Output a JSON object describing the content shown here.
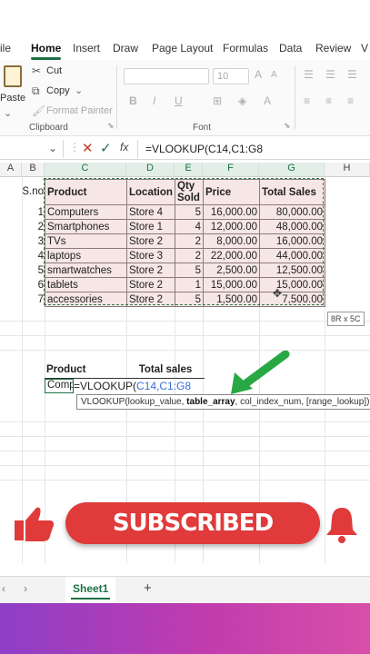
{
  "tabs": [
    "ile",
    "Home",
    "Insert",
    "Draw",
    "Page Layout",
    "Formulas",
    "Data",
    "Review",
    "V"
  ],
  "active_tab": "Home",
  "ribbon": {
    "paste": "Paste",
    "cut": "Cut",
    "copy": "Copy",
    "format_painter": "Format Painter",
    "clipboard_group": "Clipboard",
    "font_group": "Font",
    "font_size": "10",
    "bold": "B",
    "italic": "I",
    "underline": "U"
  },
  "formula_bar": {
    "formula": "=VLOOKUP(C14,C1:G8",
    "fx": "fx"
  },
  "columns": [
    "A",
    "B",
    "C",
    "D",
    "E",
    "F",
    "G",
    "H"
  ],
  "table": {
    "sno_header": "S.no",
    "headers": [
      "Product",
      "Location",
      "Qty Sold",
      "Price",
      "Total Sales"
    ],
    "rows": [
      {
        "sno": "1",
        "product": "Computers",
        "location": "Store 4",
        "qty": "5",
        "price": "16,000.00",
        "total": "80,000.00"
      },
      {
        "sno": "2",
        "product": "Smartphones",
        "location": "Store 1",
        "qty": "4",
        "price": "12,000.00",
        "total": "48,000.00"
      },
      {
        "sno": "3",
        "product": "TVs",
        "location": "Store 2",
        "qty": "2",
        "price": "8,000.00",
        "total": "16,000.00"
      },
      {
        "sno": "4",
        "product": "laptops",
        "location": "Store 3",
        "qty": "2",
        "price": "22,000.00",
        "total": "44,000.00"
      },
      {
        "sno": "5",
        "product": "smartwatches",
        "location": "Store 2",
        "qty": "5",
        "price": "2,500.00",
        "total": "12,500.00"
      },
      {
        "sno": "6",
        "product": "tablets",
        "location": "Store 2",
        "qty": "1",
        "price": "15,000.00",
        "total": "15,000.00"
      },
      {
        "sno": "7",
        "product": "accessories",
        "location": "Store 2",
        "qty": "5",
        "price": "1,500.00",
        "total": "7,500.00"
      }
    ]
  },
  "size_badge": "8R x 5C",
  "lookup": {
    "product_header": "Product",
    "total_header": "Total sales",
    "cell_value": "Comp",
    "formula_prefix": "=VLOOKUP(",
    "formula_ref": "C14,C1:G8"
  },
  "tooltip": {
    "prefix": "VLOOKUP(lookup_value, ",
    "bold": "table_array",
    "suffix": ", col_index_num, [range_lookup])"
  },
  "banner_text": "SUBSCRIBED",
  "sheet_tab": "Sheet1",
  "colors": {
    "accent": "#1e7145",
    "banner": "#e03a3a",
    "table_fill": "#f7e6e6"
  }
}
